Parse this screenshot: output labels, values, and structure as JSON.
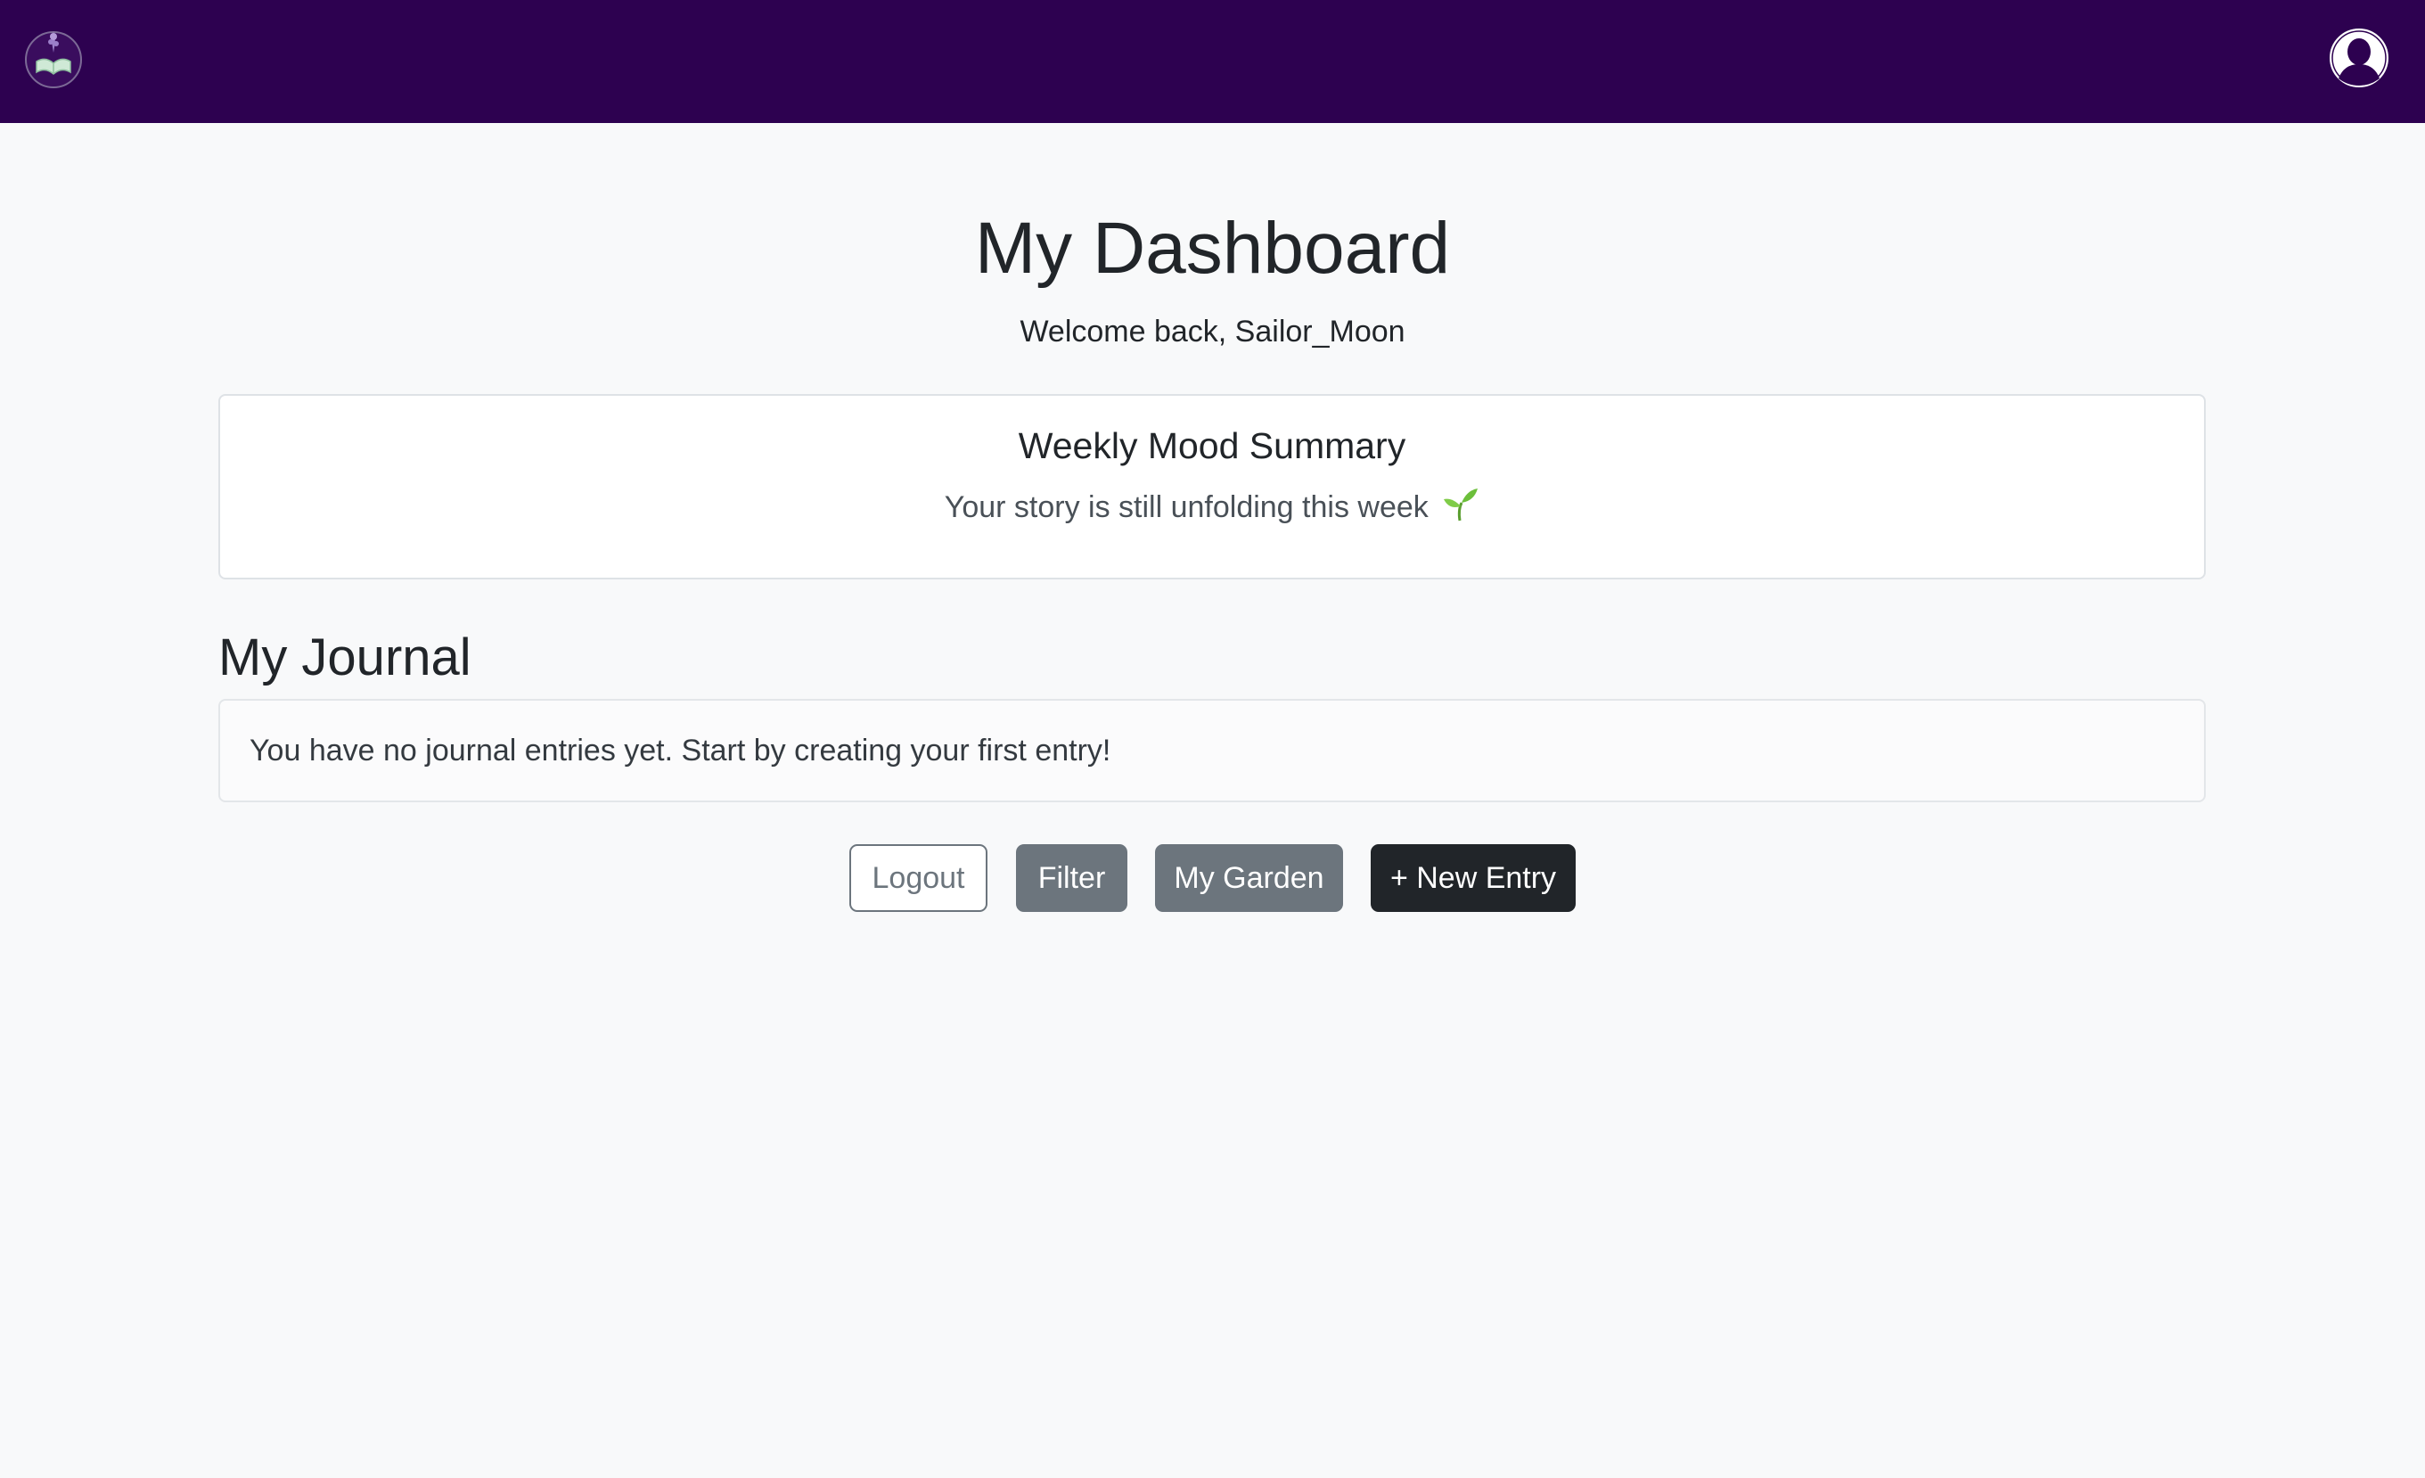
{
  "navbar": {
    "logo_icon": "book-with-flower-logo-icon",
    "avatar_icon": "user-avatar-icon",
    "background_color": "#2d0150"
  },
  "header": {
    "title": "My Dashboard",
    "welcome": "Welcome back, Sailor_Moon"
  },
  "mood_summary": {
    "title": "Weekly Mood Summary",
    "text": "Your story is still unfolding this week",
    "icon": "sprout-icon"
  },
  "journal": {
    "title": "My Journal",
    "empty_message": "You have no journal entries yet. Start by creating your first entry!"
  },
  "actions": {
    "logout_label": "Logout",
    "filter_label": "Filter",
    "garden_label": "My Garden",
    "new_entry_label": "+ New Entry"
  },
  "colors": {
    "secondary": "#6c757d",
    "dark": "#212529",
    "page_background": "#f8f9fa"
  }
}
